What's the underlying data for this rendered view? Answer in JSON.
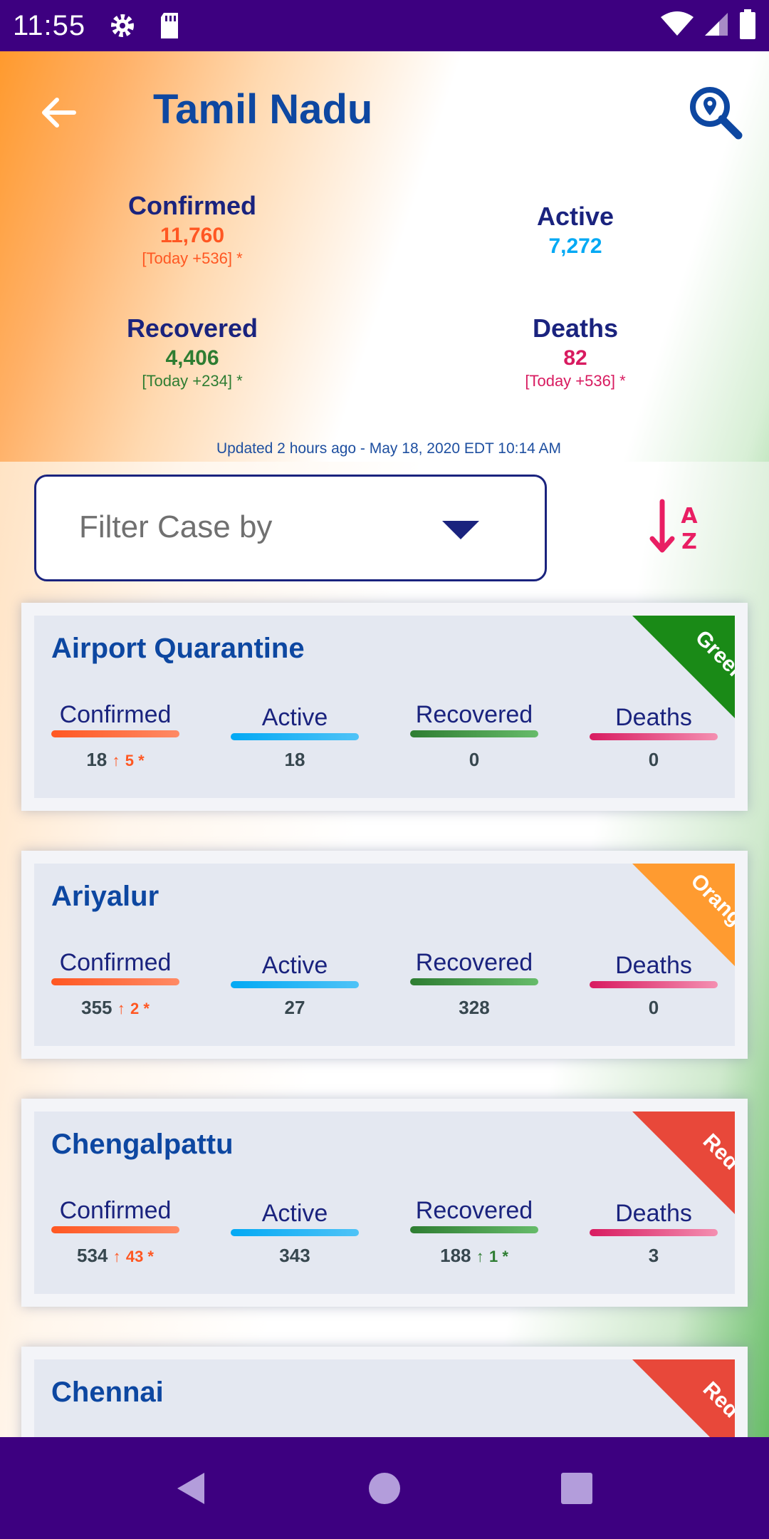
{
  "status_bar": {
    "time": "11:55",
    "icons": [
      "gear-icon",
      "sd-card-icon",
      "wifi-icon",
      "signal-icon",
      "battery-icon"
    ]
  },
  "header": {
    "title": "Tamil Nadu",
    "back_icon": "arrow-left-icon",
    "search_icon": "search-location-icon"
  },
  "summary": {
    "confirmed": {
      "label": "Confirmed",
      "value": "11,760",
      "today": "[Today +536] *",
      "color": "#ff5722"
    },
    "active": {
      "label": "Active",
      "value": "7,272",
      "color": "#03a9f4"
    },
    "recovered": {
      "label": "Recovered",
      "value": "4,406",
      "today": "[Today +234] *",
      "color": "#2e7d32"
    },
    "deaths": {
      "label": "Deaths",
      "value": "82",
      "today": "[Today +536] *",
      "color": "#d81b60"
    },
    "updated": "Updated 2 hours ago - May 18, 2020 EDT 10:14 AM"
  },
  "filter": {
    "placeholder": "Filter Case by",
    "sort_icon": "sort-alpha-down-icon"
  },
  "stat_labels": {
    "confirmed": "Confirmed",
    "active": "Active",
    "recovered": "Recovered",
    "deaths": "Deaths"
  },
  "districts": [
    {
      "name": "Airport Quarantine",
      "zone": "Green",
      "zone_color": "#1a8a17",
      "confirmed": "18",
      "confirmed_delta": "5 *",
      "active": "18",
      "recovered": "0",
      "recovered_delta": "",
      "deaths": "0"
    },
    {
      "name": "Ariyalur",
      "zone": "Orange",
      "zone_color": "#ff9b30",
      "confirmed": "355",
      "confirmed_delta": "2 *",
      "active": "27",
      "recovered": "328",
      "recovered_delta": "",
      "deaths": "0"
    },
    {
      "name": "Chengalpattu",
      "zone": "Red",
      "zone_color": "#e8483a",
      "confirmed": "534",
      "confirmed_delta": "43 *",
      "active": "343",
      "recovered": "188",
      "recovered_delta": "1 *",
      "deaths": "3"
    },
    {
      "name": "Chennai",
      "zone": "Red",
      "zone_color": "#e8483a"
    }
  ],
  "nav": {
    "back": "nav-back-icon",
    "home": "nav-home-icon",
    "recents": "nav-recents-icon"
  }
}
